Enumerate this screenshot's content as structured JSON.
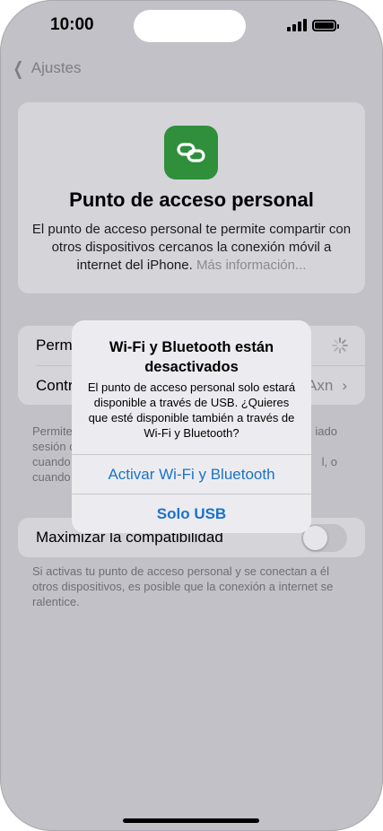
{
  "status_bar": {
    "time": "10:00",
    "signal_icon": "cellular-signal-icon",
    "battery_icon": "battery-icon"
  },
  "nav": {
    "back_label": "Ajustes",
    "back_icon": "chevron-left-icon"
  },
  "hero": {
    "icon": "link-chain-icon",
    "icon_color": "#2f8f3b",
    "title": "Punto de acceso personal",
    "description": "El punto de acceso personal te permite compartir con otros dispositivos cercanos la conexión móvil a internet del iPhone.",
    "more_link": "Más información..."
  },
  "settings": {
    "row1_label": "Perm",
    "row2_label": "Contr",
    "row2_value": "Axn"
  },
  "footnote1": {
    "line1_left": "Permite",
    "line1_right": "iado",
    "line2_left": "sesión c",
    "line3_left": "cuando",
    "line3_right": "l, o",
    "line4_left": "cuando"
  },
  "max_compat": {
    "label": "Maximizar la compatibilidad",
    "toggle_on": false
  },
  "footnote2": "Si activas tu punto de acceso personal y se conectan a él otros dispositivos, es posible que la conexión a internet se ralentice.",
  "alert": {
    "title": "Wi-Fi y Bluetooth están desactivados",
    "message": "El punto de acceso personal solo estará disponible a través de USB. ¿Quieres que esté disponible también a través de Wi-Fi y Bluetooth?",
    "button_primary": "Activar Wi-Fi y Bluetooth",
    "button_secondary": "Solo USB",
    "accent_color": "#1a73c9"
  }
}
